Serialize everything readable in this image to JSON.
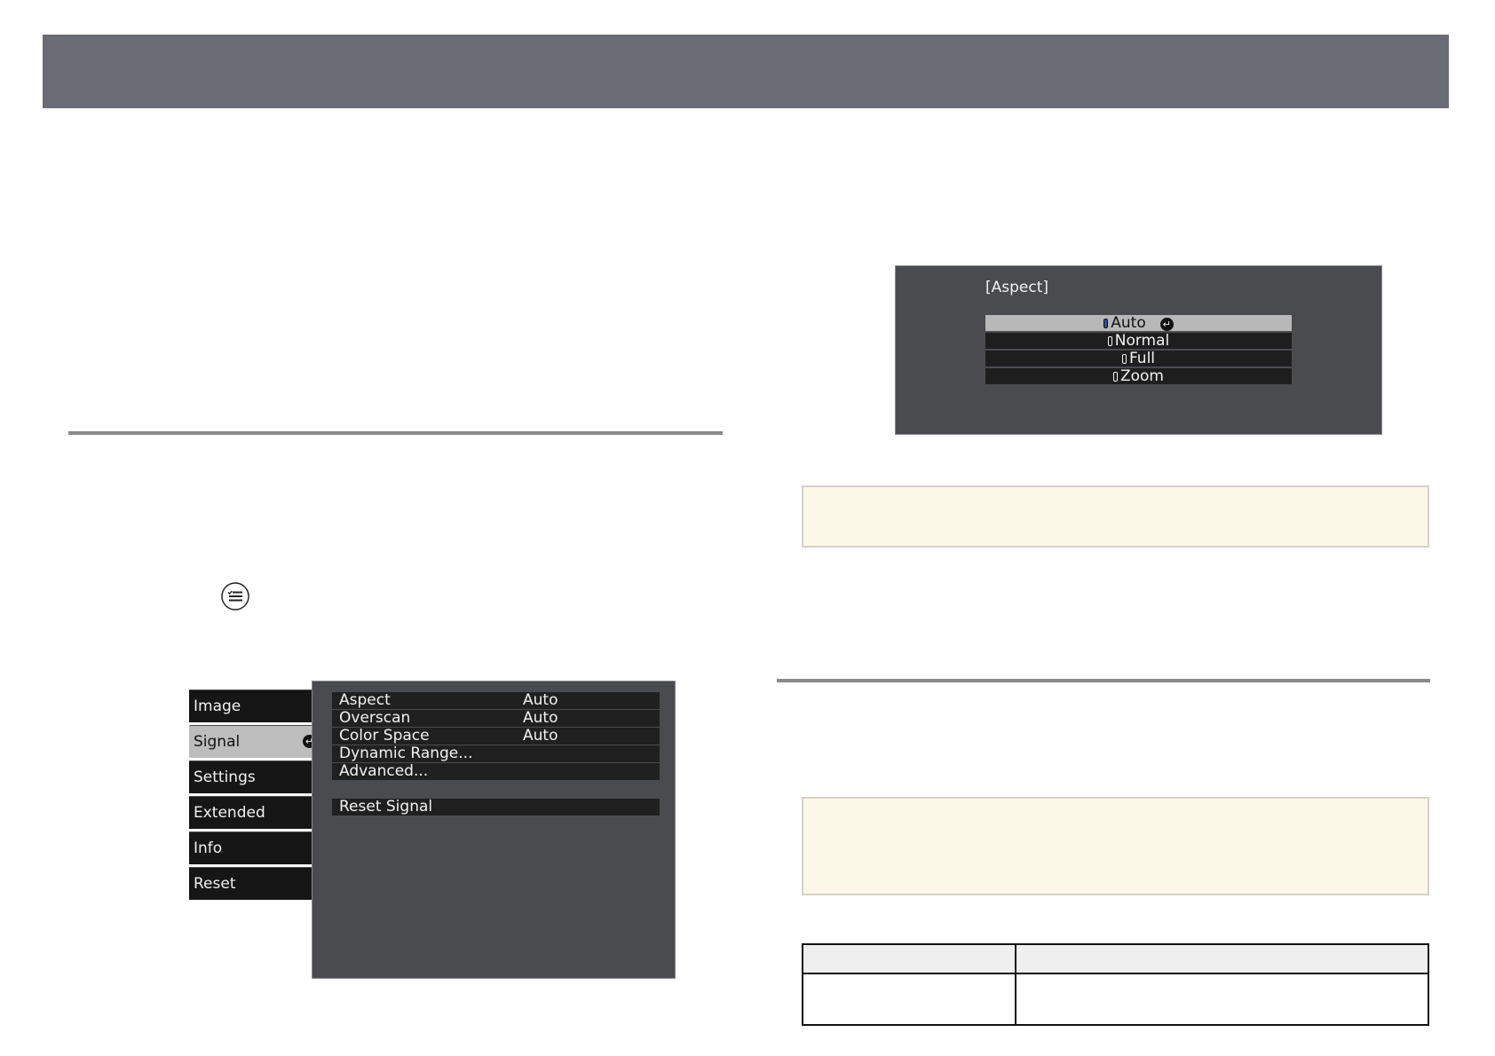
{
  "signal_menu": {
    "tabs": [
      {
        "label": "Image"
      },
      {
        "label": "Signal",
        "enter_glyph": "↵"
      },
      {
        "label": "Settings"
      },
      {
        "label": "Extended"
      },
      {
        "label": "Info"
      },
      {
        "label": "Reset"
      }
    ],
    "rows": [
      {
        "label": "Aspect",
        "value": "Auto"
      },
      {
        "label": "Overscan",
        "value": "Auto"
      },
      {
        "label": "Color Space",
        "value": "Auto"
      },
      {
        "label": "Dynamic Range...",
        "value": ""
      },
      {
        "label": "Advanced...",
        "value": ""
      }
    ],
    "reset_row": "Reset Signal"
  },
  "aspect_dialog": {
    "title": "[Aspect]",
    "options": [
      {
        "label": "Auto"
      },
      {
        "label": "Normal"
      },
      {
        "label": "Full"
      },
      {
        "label": "Zoom"
      }
    ],
    "confirm_glyph": "↵"
  },
  "colors": {
    "header_bar": "#696c74",
    "note_background": "#fcf8e8",
    "menu_background": "#4a4b4f",
    "selected_item": "#bdbdbd"
  },
  "icons": {
    "menu_button": "menu-list-icon"
  }
}
